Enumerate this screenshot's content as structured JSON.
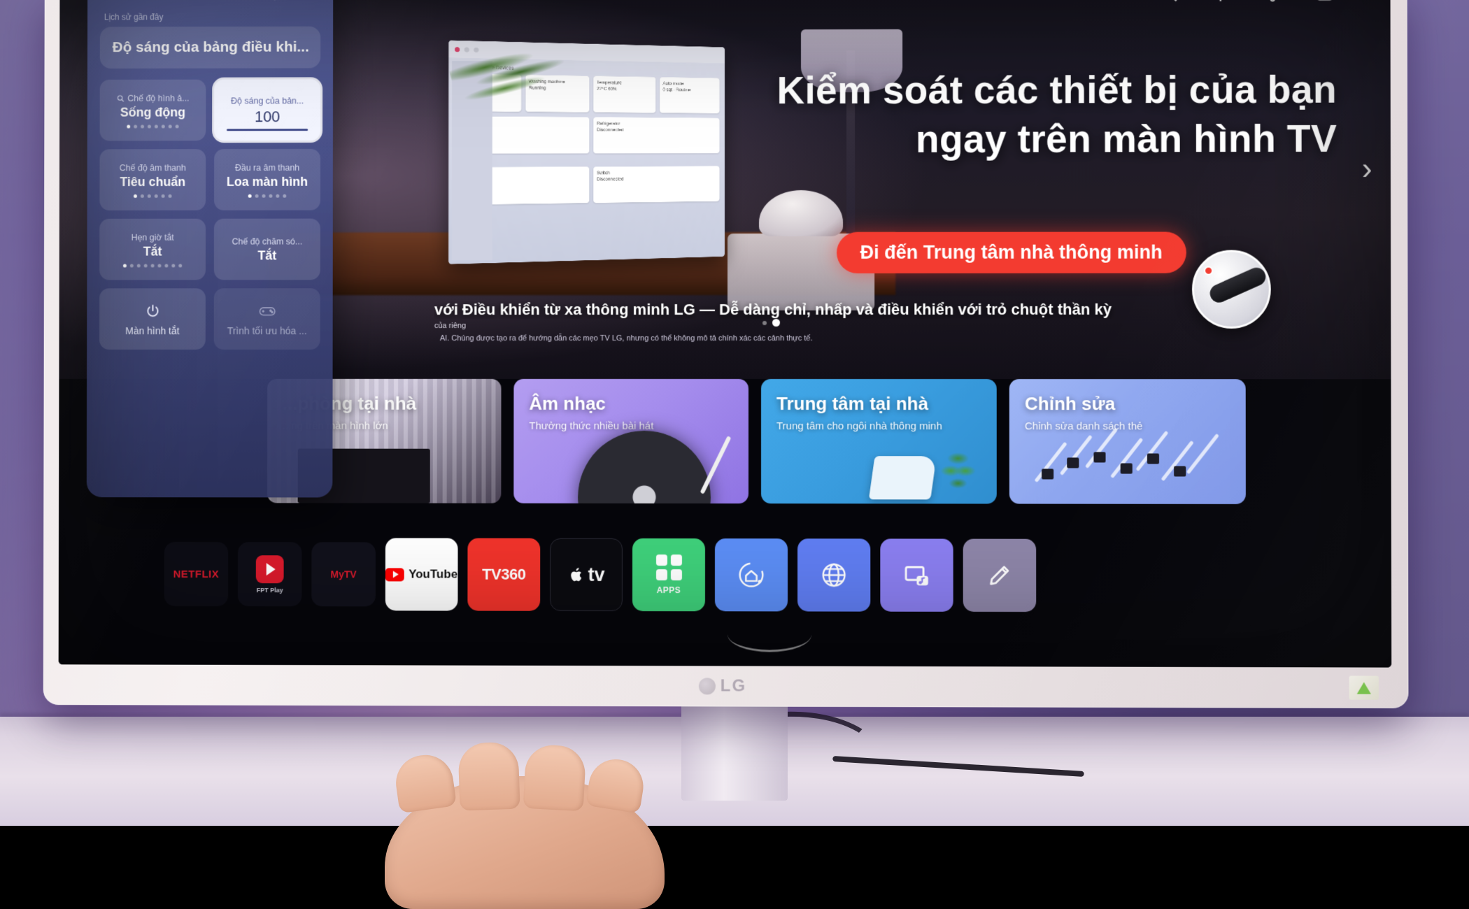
{
  "device": {
    "brand": "LG",
    "accent_red": "#f33b30",
    "panel_blue": "#566 0a0"
  },
  "top_icons": [
    {
      "name": "search-icon"
    },
    {
      "name": "settings-gear-icon"
    },
    {
      "name": "notifications-icon"
    },
    {
      "name": "profile-icon"
    }
  ],
  "quick_settings": {
    "header_icons": [
      {
        "name": "gear-icon"
      },
      {
        "name": "accessibility-icon"
      },
      {
        "name": "wifi-icon"
      },
      {
        "name": "divider"
      },
      {
        "name": "edit-pencil-icon"
      }
    ],
    "recent_label": "Lịch sử gần đây",
    "recent_item": "Độ sáng của bảng điều khi...",
    "tiles": [
      {
        "title": "Chế độ hình ả...",
        "value": "Sống động",
        "has_search_icon": true,
        "dots_total": 8,
        "dots_active": 1,
        "selected": false
      },
      {
        "title": "Độ sáng của bản...",
        "value": "100",
        "has_search_icon": false,
        "selected": true,
        "has_slider": true
      },
      {
        "title": "Chế độ âm thanh",
        "value": "Tiêu chuẩn",
        "dots_total": 6,
        "dots_active": 1,
        "selected": false
      },
      {
        "title": "Đầu ra âm thanh",
        "value": "Loa màn hình",
        "dots_total": 6,
        "dots_active": 1,
        "selected": false
      },
      {
        "title": "Hẹn giờ tắt",
        "value": "Tắt",
        "dots_total": 9,
        "dots_active": 1,
        "selected": false
      },
      {
        "title": "Chế độ chăm só...",
        "value": "Tắt",
        "dots_total": 0,
        "dots_active": 0,
        "selected": false
      }
    ],
    "action_tiles": [
      {
        "icon": "power-screen-off-icon",
        "label": "Màn hình tắt",
        "dim": false
      },
      {
        "icon": "gamepad-icon",
        "label": "Trình tối ưu hóa ...",
        "dim": true
      }
    ]
  },
  "hero": {
    "title_line1": "Kiểm soát các thiết bị của bạn",
    "title_line2": "ngay trên màn hình TV",
    "next_arrow": "›",
    "cta_label": "Đi đến Trung tâm nhà thông minh",
    "description": "với Điều khiển từ xa thông minh LG — Dễ dàng chỉ, nhấp và điều khiển với trỏ chuột thần kỳ",
    "sub_note_1": "của riêng",
    "sub_note_2": "AI. Chúng được tạo ra để hướng dẫn các mẹo TV LG, nhưng có thể không mô tả chính xác các cảnh thực tế.",
    "carousel_dots_total": 2,
    "carousel_dots_active": 2
  },
  "content_cards": [
    {
      "title": "...phòng tại nhà",
      "subtitle": "...ng trên màn hình lớn",
      "theme": "home"
    },
    {
      "title": "Âm nhạc",
      "subtitle": "Thưởng thức nhiều bài hát",
      "theme": "music"
    },
    {
      "title": "Trung tâm tại nhà",
      "subtitle": "Trung tâm cho ngôi nhà thông minh",
      "theme": "hub"
    },
    {
      "title": "Chỉnh sửa",
      "subtitle": "Chỉnh sửa danh sách thẻ",
      "theme": "edit"
    }
  ],
  "apps": [
    {
      "name": "netflix",
      "label": "NETFLIX"
    },
    {
      "name": "fptplay",
      "label": "FPT Play"
    },
    {
      "name": "mytv",
      "label": "MyTV"
    },
    {
      "name": "youtube",
      "label": "YouTube"
    },
    {
      "name": "tv360",
      "label": "TV360"
    },
    {
      "name": "appletv",
      "label": "tv"
    },
    {
      "name": "apps",
      "label": "APPS"
    },
    {
      "name": "smarthome",
      "label": ""
    },
    {
      "name": "webbrowser",
      "label": ""
    },
    {
      "name": "screenshare",
      "label": ""
    },
    {
      "name": "editapps",
      "label": ""
    }
  ],
  "chassis": {
    "logo": "LG"
  }
}
